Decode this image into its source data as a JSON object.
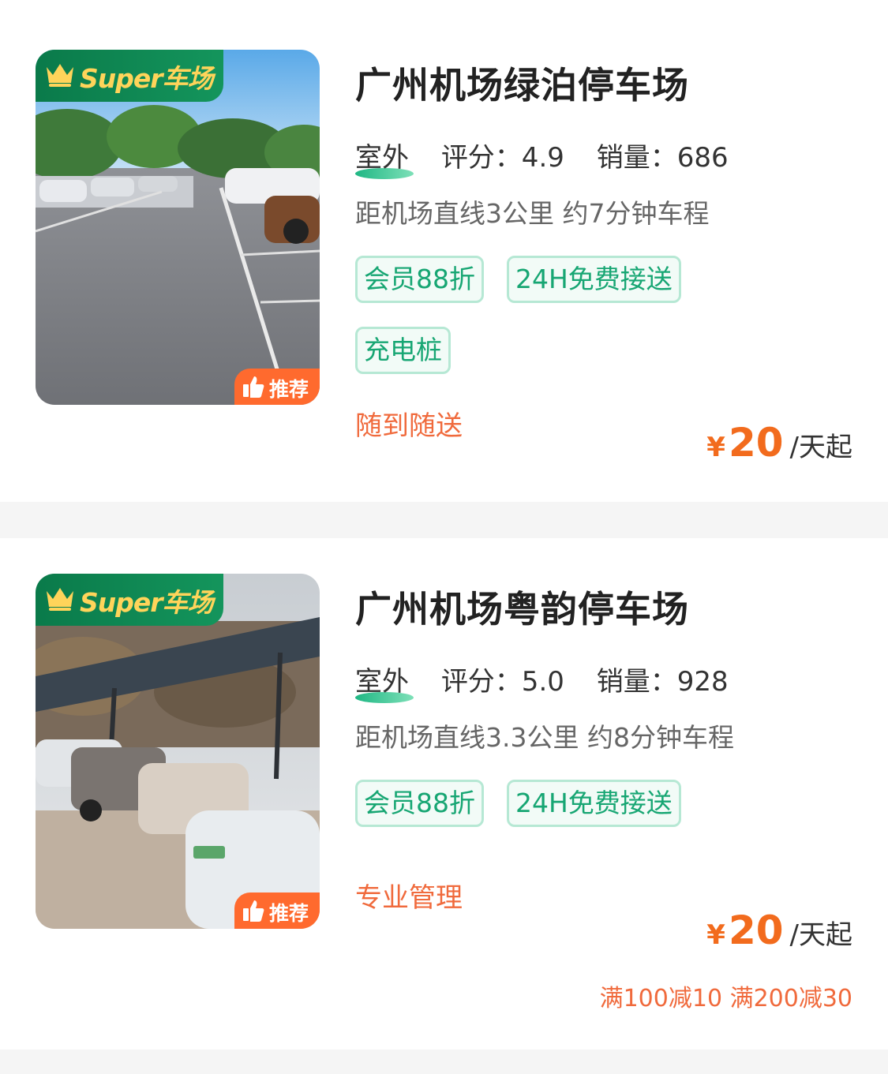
{
  "listings": [
    {
      "name": "广州机场绿泊停车场",
      "badge": "Super车场",
      "recommend": "推荐",
      "location_type": "室外",
      "rating_label": "评分：4.9",
      "sales_label": "销量：686",
      "distance": "距机场直线3公里 约7分钟车程",
      "tags": [
        "会员88折",
        "24H免费接送",
        "充电桩"
      ],
      "service": "随到随送",
      "price_currency": "¥",
      "price_amount": "20",
      "price_unit": "/天起",
      "promo": ""
    },
    {
      "name": "广州机场粤韵停车场",
      "badge": "Super车场",
      "recommend": "推荐",
      "location_type": "室外",
      "rating_label": "评分：5.0",
      "sales_label": "销量：928",
      "distance": "距机场直线3.3公里 约8分钟车程",
      "tags": [
        "会员88折",
        "24H免费接送"
      ],
      "service": "专业管理",
      "price_currency": "¥",
      "price_amount": "20",
      "price_unit": "/天起",
      "promo": "满100减10 满200减30"
    }
  ],
  "colors": {
    "brand_green": "#14955c",
    "badge_gold": "#ffd45a",
    "accent_orange": "#f26b1d",
    "tag_green": "#17a673"
  }
}
